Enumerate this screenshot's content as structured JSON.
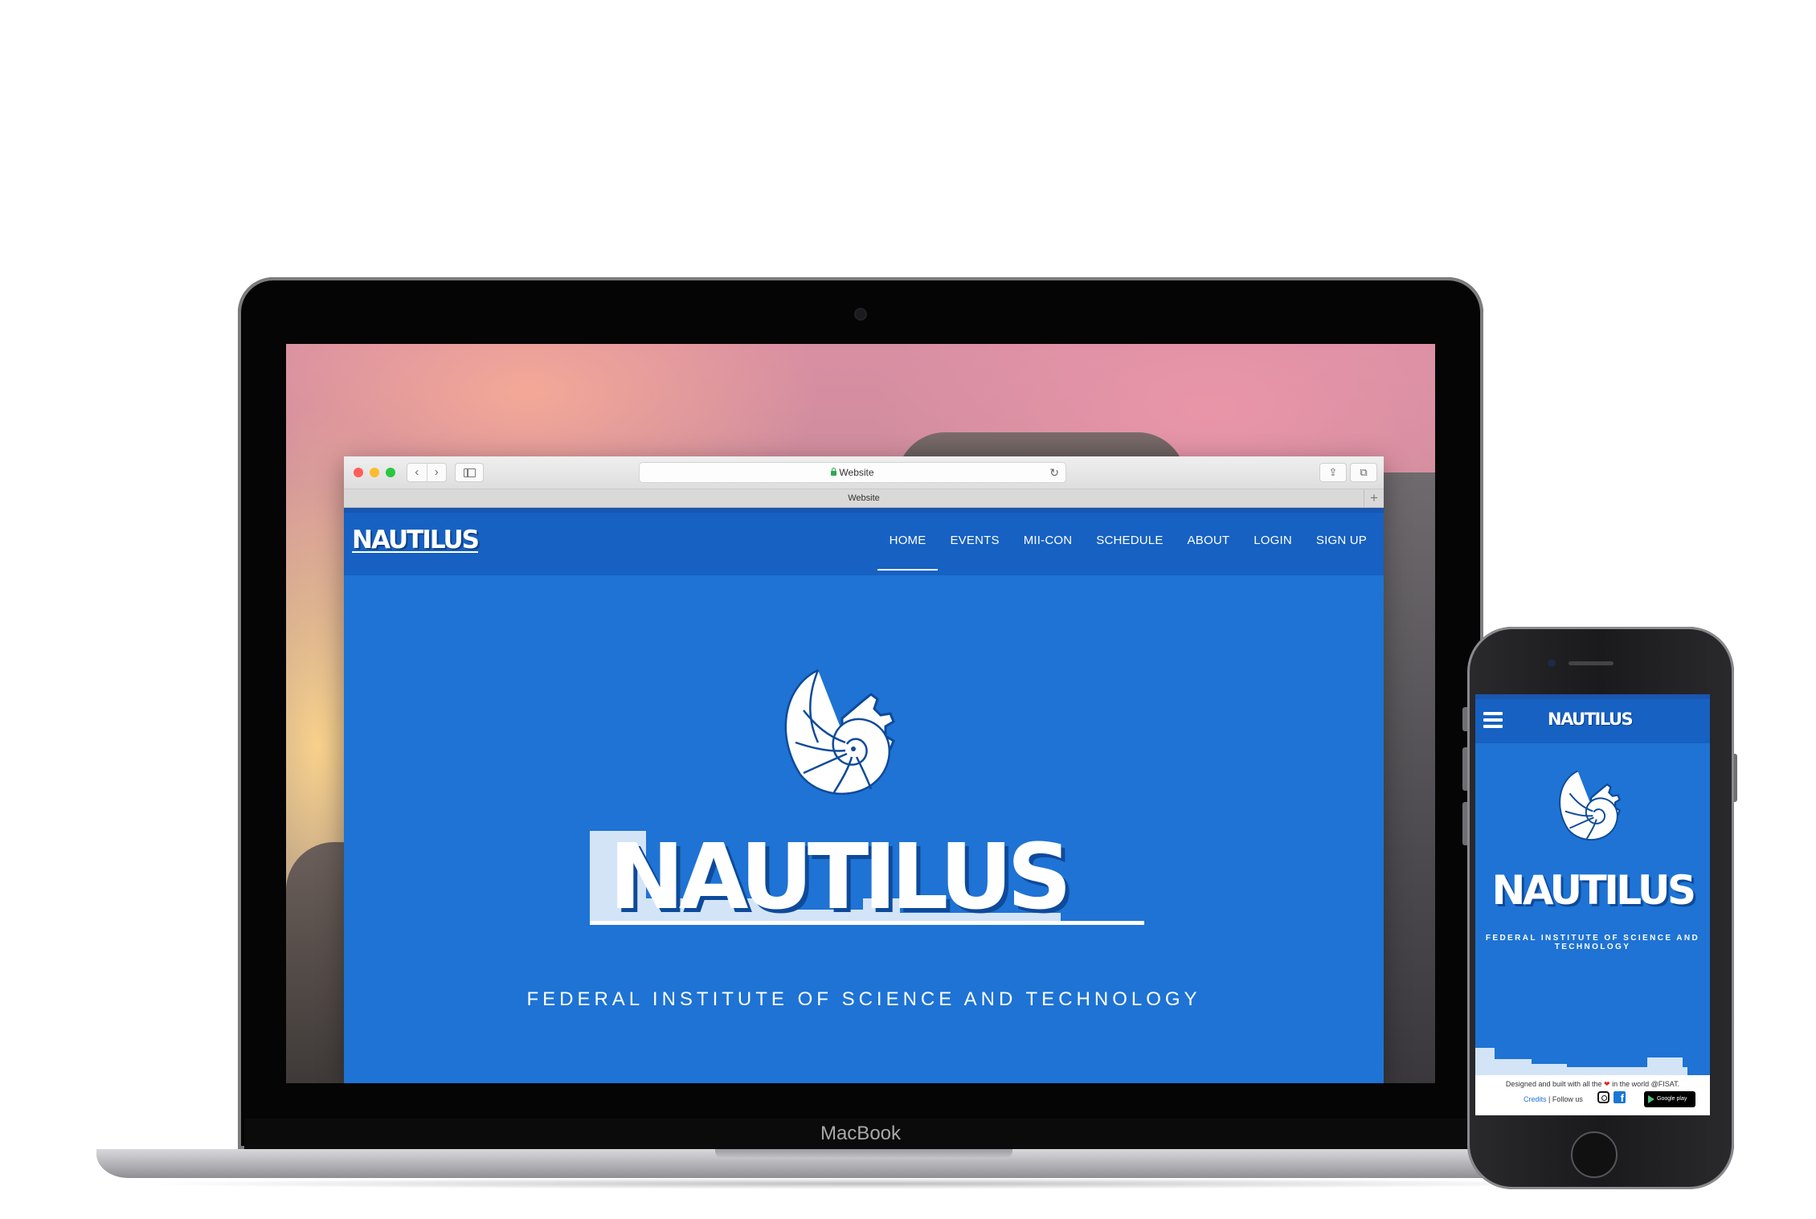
{
  "laptop": {
    "brand": "MacBook",
    "browser": {
      "url": "Website",
      "tab_title": "Website",
      "back_icon": "chevron-left-icon",
      "forward_icon": "chevron-right-icon",
      "new_tab": "+"
    },
    "site": {
      "logo": "NAUTILUS",
      "menu": [
        "HOME",
        "EVENTS",
        "MII-CON",
        "SCHEDULE",
        "ABOUT",
        "LOGIN",
        "SIGN UP"
      ],
      "active_menu": "HOME",
      "hero_title": "NAUTILUS",
      "hero_subtitle": "FEDERAL INSTITUTE OF SCIENCE AND TECHNOLOGY"
    }
  },
  "phone": {
    "site": {
      "logo": "NAUTILUS",
      "hero_title": "NAUTILUS",
      "hero_subtitle": "FEDERAL INSTITUTE OF SCIENCE AND TECHNOLOGY",
      "footer_line_prefix": "Designed and built with all the",
      "footer_line_suffix": "in the world @FISAT.",
      "credits": "Credits",
      "follow": "| Follow us",
      "google_play": "Google play"
    }
  },
  "colors": {
    "site_blue": "#1e73d4",
    "nav_blue": "#1661c2"
  }
}
